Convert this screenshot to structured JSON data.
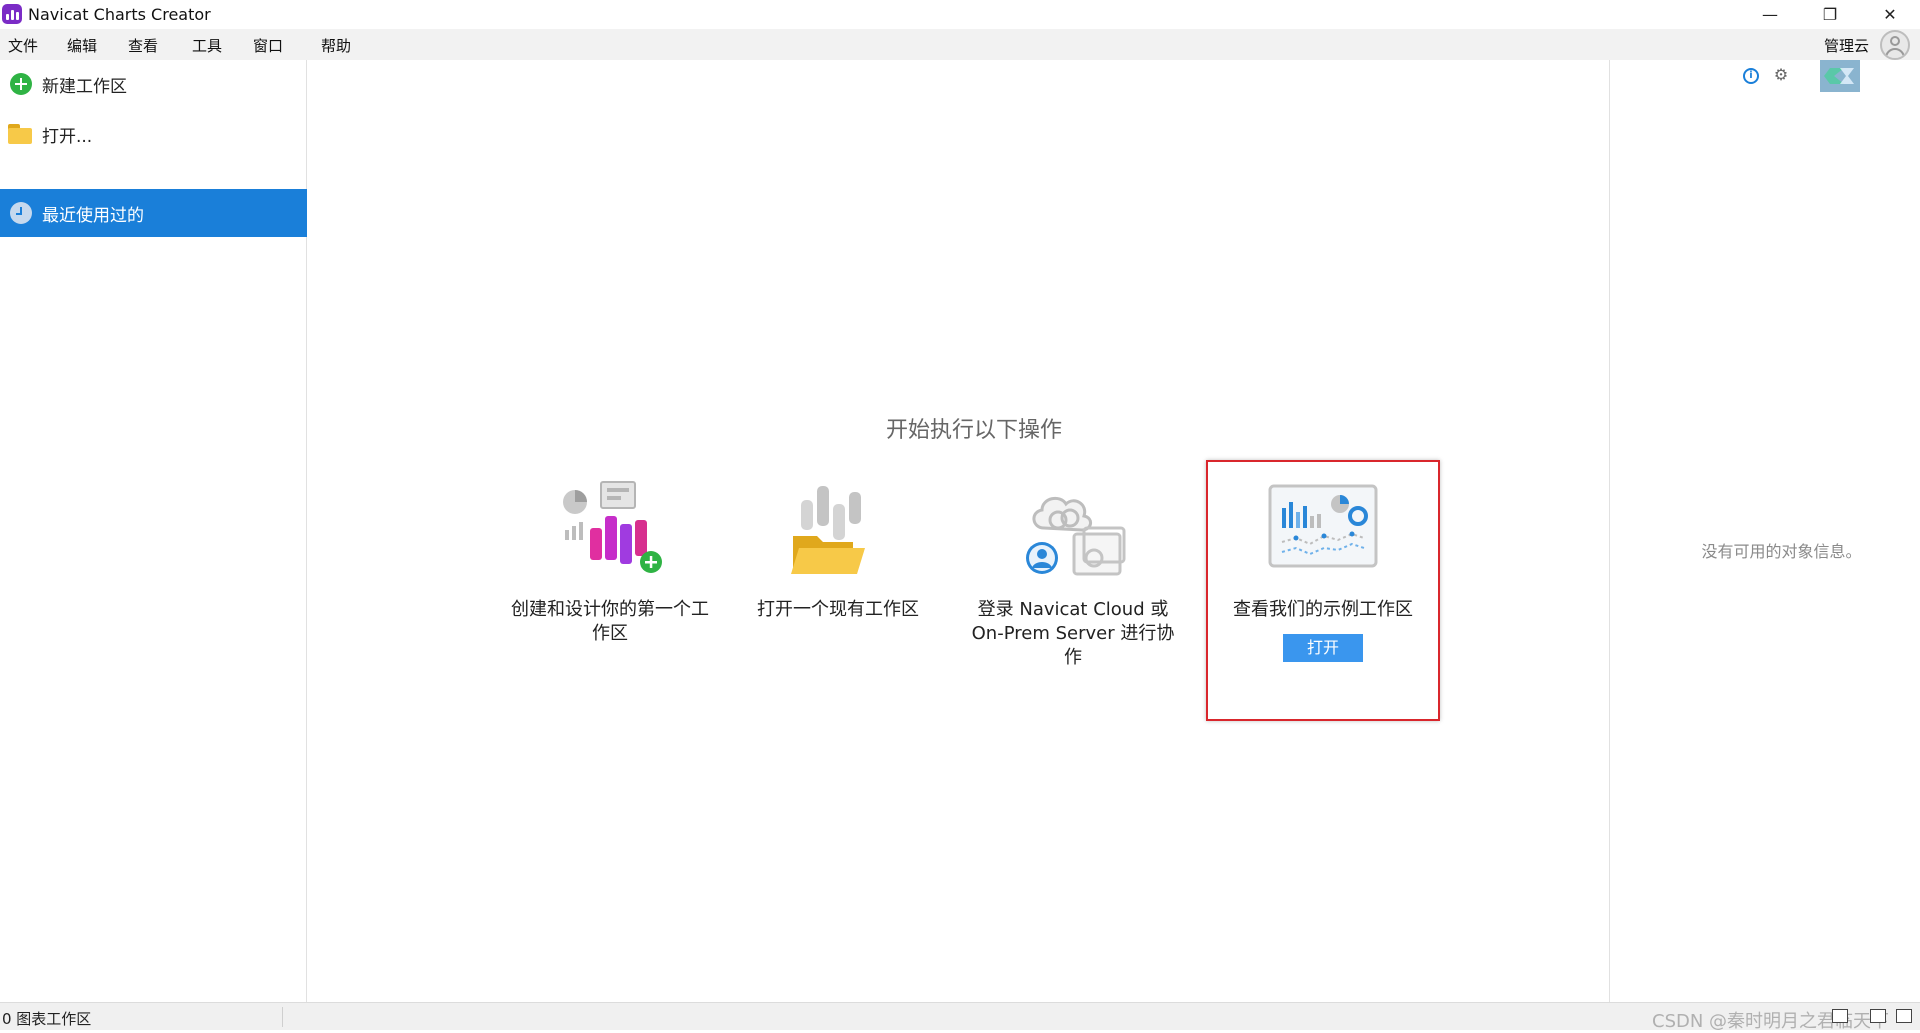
{
  "window": {
    "title": "Navicat Charts Creator",
    "minimize_glyph": "—",
    "restore_glyph": "❐",
    "close_glyph": "✕"
  },
  "menu": {
    "items": [
      "文件",
      "编辑",
      "查看",
      "工具",
      "窗口",
      "帮助"
    ],
    "cloud_label": "管理云"
  },
  "sidebar": {
    "new_workspace": "新建工作区",
    "open": "打开...",
    "recent": "最近使用过的"
  },
  "main": {
    "title": "开始执行以下操作",
    "cards": [
      {
        "caption": "创建和设计你的第一个工作区"
      },
      {
        "caption": "打开一个现有工作区"
      },
      {
        "caption": "登录 Navicat Cloud 或 On-Prem Server 进行协作"
      },
      {
        "caption": "查看我们的示例工作区",
        "button": "打开"
      }
    ]
  },
  "right_panel": {
    "empty_message": "没有可用的对象信息。"
  },
  "status": {
    "workspace_count": "0 图表工作区",
    "watermark": "CSDN @秦时明月之君临天下"
  },
  "colors": {
    "accent": "#1a7fd9",
    "button": "#3a96ee",
    "highlight_border": "#d9262c"
  }
}
